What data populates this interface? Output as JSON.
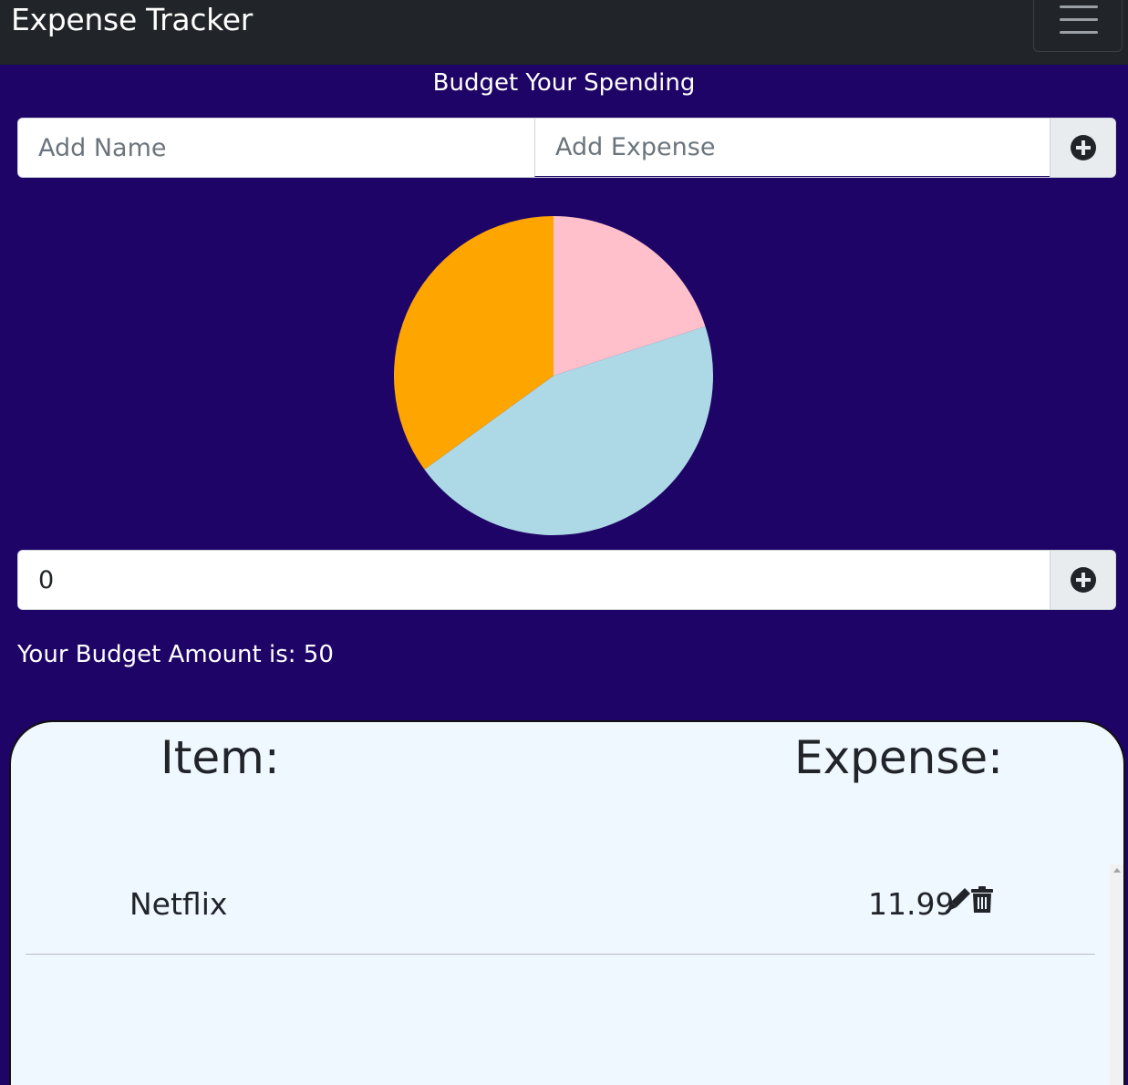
{
  "navbar": {
    "brand": "Expense Tracker",
    "toggler_icon": "hamburger-menu-icon"
  },
  "subtitle": "Budget Your Spending",
  "expense_form": {
    "name_placeholder": "Add Name",
    "expense_placeholder": "Add Expense",
    "add_icon": "plus-circle-icon"
  },
  "chart_data": {
    "type": "pie",
    "title": "",
    "slices": [
      {
        "label": "",
        "value": 20,
        "color": "#ffc0cb"
      },
      {
        "label": "",
        "value": 45,
        "color": "#add8e6"
      },
      {
        "label": "",
        "value": 35,
        "color": "#ffa500"
      }
    ]
  },
  "budget_form": {
    "value": "0",
    "add_icon": "plus-circle-icon"
  },
  "budget_text": "Your Budget Amount is: 50",
  "table": {
    "item_header": "Item:",
    "expense_header": "Expense:",
    "rows": [
      {
        "name": "Netflix",
        "expense": "11.99",
        "edit_icon": "pen-icon",
        "delete_icon": "trash-icon"
      }
    ]
  },
  "colors": {
    "page_background": "#1e0466",
    "navbar_background": "#212529",
    "card_background": "#f0f8ff"
  }
}
